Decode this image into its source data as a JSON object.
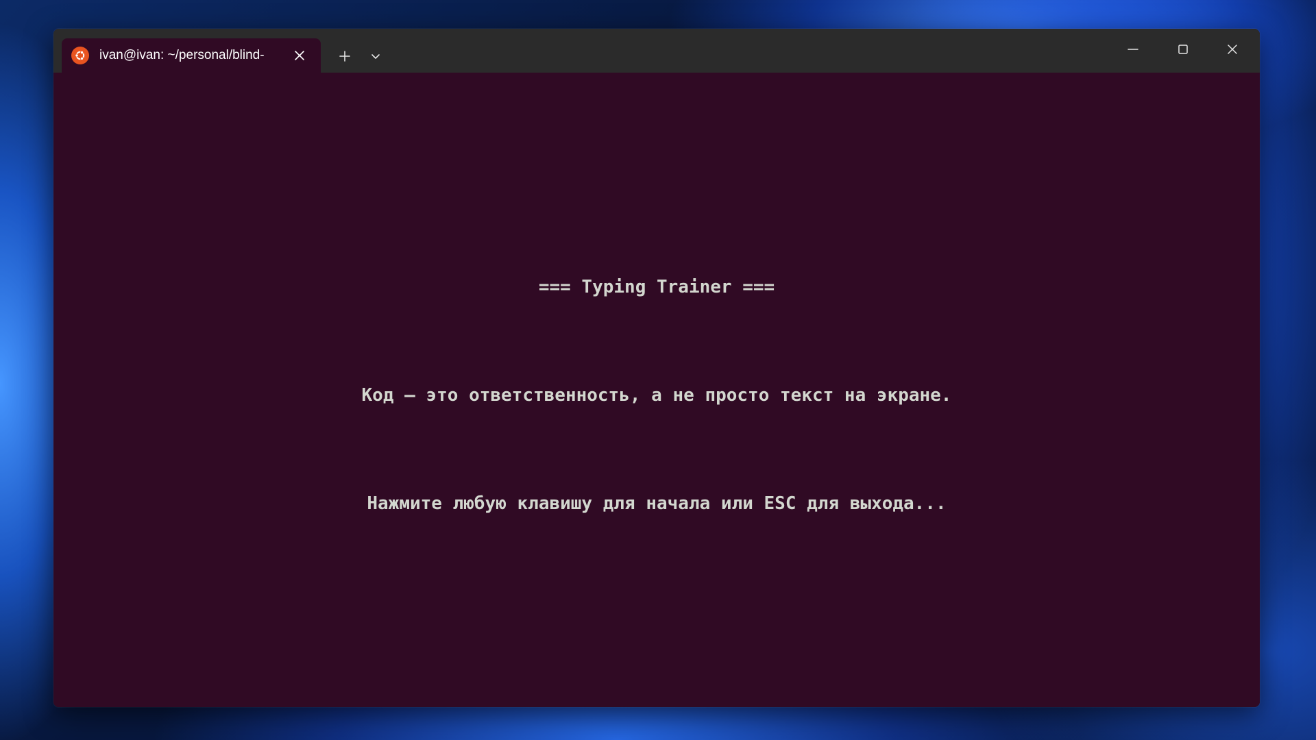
{
  "window": {
    "tab_title": "ivan@ivan: ~/personal/blind-",
    "tab_icon": "ubuntu-icon",
    "new_tab_icon": "plus-icon",
    "dropdown_icon": "chevron-down-icon",
    "minimize_icon": "minimize-icon",
    "maximize_icon": "maximize-icon",
    "close_icon": "close-icon"
  },
  "terminal": {
    "title": "=== Typing Trainer ===",
    "quote": "Код – это ответственность, а не просто текст на экране.",
    "prompt": "Нажмите любую клавишу для начала или ESC для выхода..."
  },
  "colors": {
    "terminal_bg": "#300a24",
    "terminal_fg": "#d3d7cf",
    "titlebar_bg": "#2b2b2b",
    "ubuntu_orange": "#e95420"
  }
}
